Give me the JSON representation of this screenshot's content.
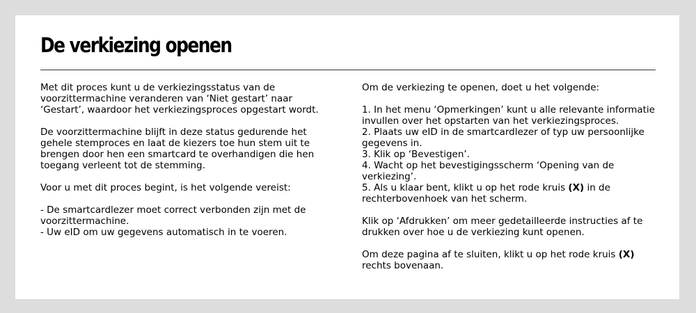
{
  "title": "De verkiezing openen",
  "left": {
    "intro": "Met dit proces kunt u de verkiezingsstatus van de voorzittermachine veranderen van ‘Niet gestart’ naar ‘Gestart’, waardoor het verkiezingsproces opgestart wordt.",
    "status": "De voorzittermachine blijft in deze status gedurende het gehele stemproces en laat de kiezers toe hun stem uit te brengen door hen een smartcard te overhandigen die hen toegang verleent tot de stemming.",
    "requirements_intro": "Voor u met dit proces begint, is het volgende vereist:",
    "requirements": [
      "- De smartcardlezer moet correct verbonden zijn met de voorzittermachine.",
      "- Uw eID om uw gegevens automatisch in te voeren."
    ]
  },
  "right": {
    "steps_intro": "Om de verkiezing te openen, doet u het volgende:",
    "steps": [
      "1. In het menu ‘Opmerkingen’ kunt u alle relevante informatie invullen over het opstarten van het verkiezingsproces.",
      "2. Plaats uw eID in de smartcardlezer of typ uw persoonlijke gegevens in.",
      "3. Klik op ‘Bevestigen’.",
      "4. Wacht op het bevestigingsscherm ‘Opening van de verkiezing’."
    ],
    "step5_before": "5. Als u klaar bent, klikt u op het rode kruis ",
    "step5_bold": "(X)",
    "step5_after": " in de rechterbovenhoek van het scherm.",
    "print_text": "Klik op ‘Afdrukken’ om meer gedetailleerde instructies af te drukken over hoe u de verkiezing kunt openen.",
    "close_before": "Om deze pagina af te sluiten, klikt u op het rode kruis ",
    "close_bold": "(X)",
    "close_after": " rechts bovenaan."
  }
}
